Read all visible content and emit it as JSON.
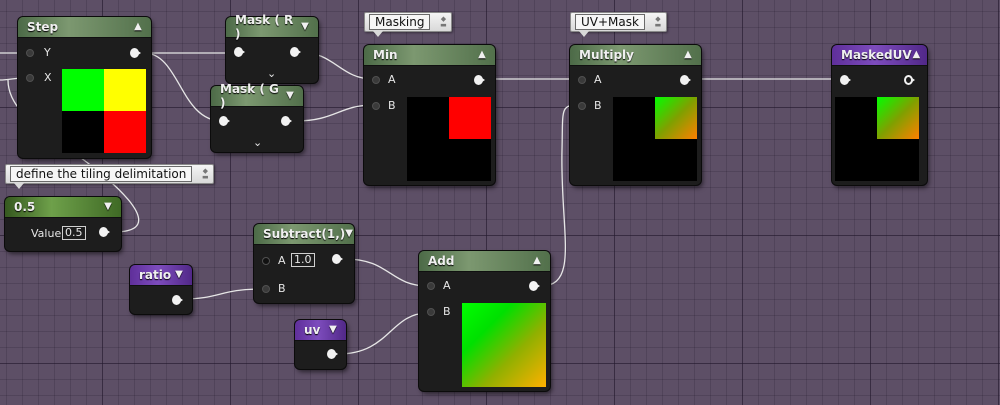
{
  "comments": {
    "masking": "Masking",
    "uvmask": "UV+Mask",
    "tiling": "define the tiling delimitation"
  },
  "nodes": {
    "step": {
      "title": "Step",
      "input_y": "Y",
      "input_x": "X"
    },
    "mask_r": {
      "title": "Mask ( R )"
    },
    "mask_g": {
      "title": "Mask ( G )"
    },
    "min": {
      "title": "Min",
      "input_a": "A",
      "input_b": "B"
    },
    "multiply": {
      "title": "Multiply",
      "input_a": "A",
      "input_b": "B"
    },
    "masked_uv": {
      "title": "MaskedUV"
    },
    "const": {
      "title": "0.5",
      "value_label": "Value",
      "value": "0.5"
    },
    "subtract": {
      "title": "Subtract(1,)",
      "input_a": "A",
      "input_a_value": "1.0",
      "input_b": "B"
    },
    "ratio": {
      "title": "ratio"
    },
    "add": {
      "title": "Add",
      "input_a": "A",
      "input_b": "B"
    },
    "uv": {
      "title": "uv"
    }
  },
  "icons": {
    "collapse": "chevron-up-icon",
    "dropdown": "chevron-down-icon",
    "expand": "chevron-down-icon",
    "comment_grip": "grip-icon"
  },
  "colors": {
    "graph_background": "#5d4f66",
    "material_header": "#7c9870",
    "parameter_header": "#7d4cbd",
    "output_pin": "#f2f2f2",
    "wire": "#e8e8e8"
  }
}
